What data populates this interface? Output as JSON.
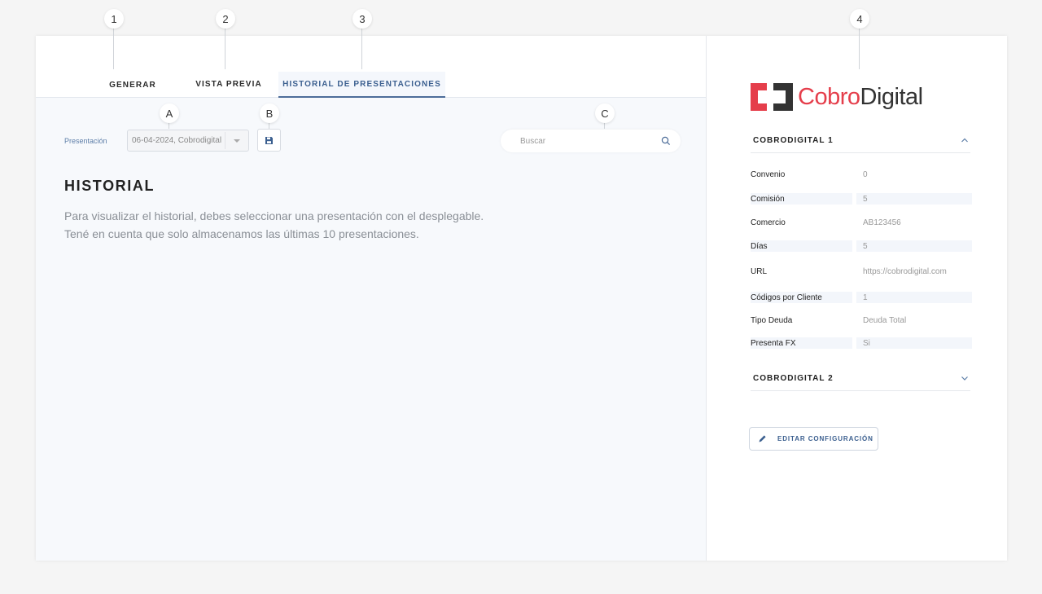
{
  "callouts": [
    "1",
    "2",
    "3",
    "4",
    "A",
    "B",
    "C"
  ],
  "tabs": [
    {
      "label": "GENERAR"
    },
    {
      "label": "VISTA PREVIA"
    },
    {
      "label": "HISTORIAL DE PRESENTACIONES",
      "active": true
    }
  ],
  "toolbar": {
    "presentation_label": "Presentación",
    "presentation_value": "06-04-2024, Cobrodigital",
    "save_icon": "floppy-disk-icon",
    "search_placeholder": "Buscar",
    "search_icon": "search-icon"
  },
  "main": {
    "title": "HISTORIAL",
    "line1": "Para visualizar el historial, debes seleccionar una presentación con el desplegable.",
    "line2": "Tené en cuenta que solo almacenamos las últimas 10 presentaciones."
  },
  "sidebar": {
    "logo": {
      "part1": "Cobro",
      "part2": "Digital"
    },
    "sections": [
      {
        "title": "COBRODIGITAL 1",
        "expanded": true,
        "rows": [
          {
            "key": "Convenio",
            "value": "0"
          },
          {
            "key": "Comisión",
            "value": "5"
          },
          {
            "key": "Comercio",
            "value": "AB123456"
          },
          {
            "key": "Días",
            "value": "5"
          },
          {
            "key": "URL",
            "value": "https://cobrodigital.com"
          },
          {
            "key": "Códigos por Cliente",
            "value": "1"
          },
          {
            "key": "Tipo Deuda",
            "value": "Deuda Total"
          },
          {
            "key": "Presenta FX",
            "value": "Si"
          }
        ]
      },
      {
        "title": "COBRODIGITAL 2",
        "expanded": false
      }
    ],
    "edit_button": "EDITAR CONFIGURACIÓN"
  },
  "colors": {
    "accent": "#3b5f8f",
    "brand_red": "#e53e4b",
    "brand_dark": "#333333"
  }
}
